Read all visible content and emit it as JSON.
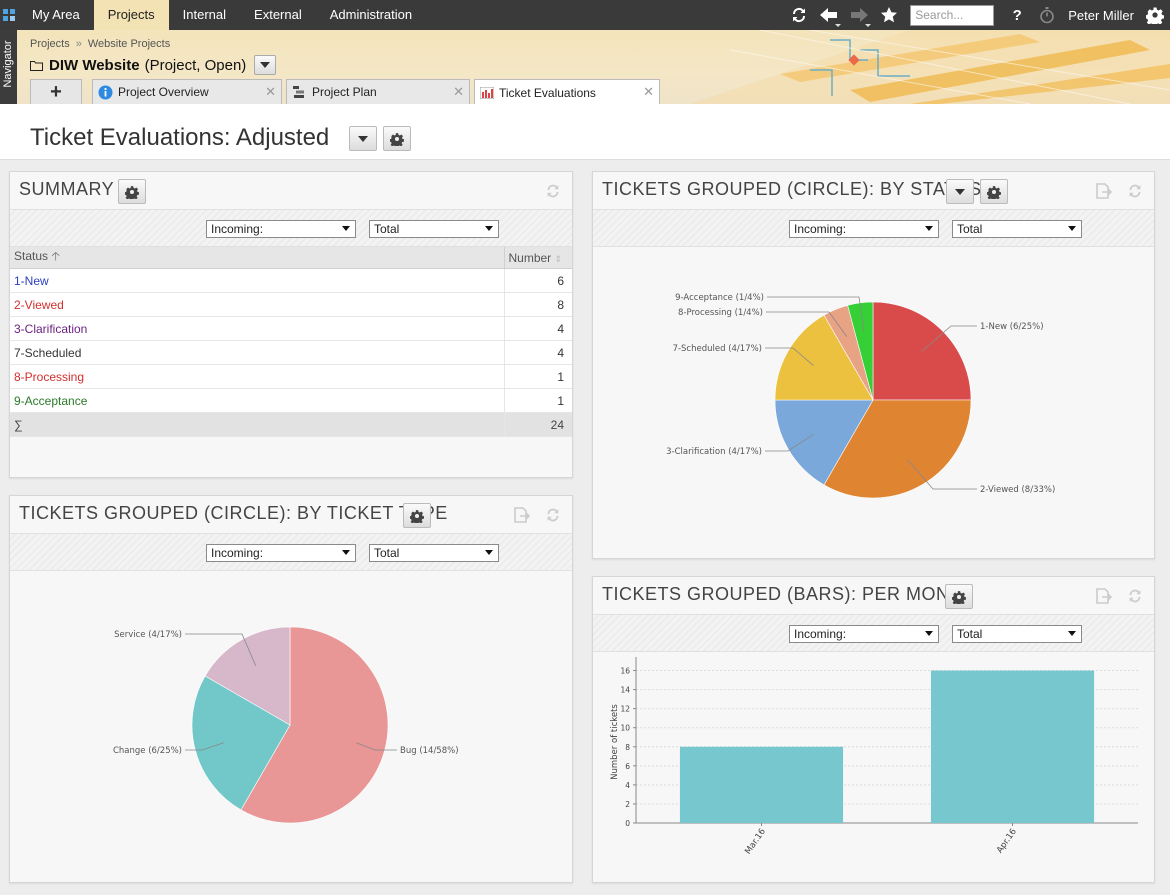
{
  "topbar": {
    "menu": [
      {
        "label": "My Area",
        "active": false
      },
      {
        "label": "Projects",
        "active": true
      },
      {
        "label": "Internal",
        "active": false
      },
      {
        "label": "External",
        "active": false
      },
      {
        "label": "Administration",
        "active": false
      }
    ],
    "search_placeholder": "Search...",
    "user": "Peter Miller",
    "help": "?"
  },
  "navigator_label": "Navigator",
  "breadcrumb": [
    "Projects",
    "Website Projects"
  ],
  "breadcrumb_sep": "»",
  "project": {
    "name": "DIW Website",
    "type": "(Project, Open)"
  },
  "tabs": [
    {
      "label": "Project Overview",
      "icon": "info-icon"
    },
    {
      "label": "Project Plan",
      "icon": "plan-icon"
    },
    {
      "label": "Ticket Evaluations",
      "icon": "chart-icon",
      "active": true
    }
  ],
  "page_title": "Ticket Evaluations: Adjusted",
  "filters": {
    "incoming": "Incoming:",
    "total": "Total"
  },
  "summary": {
    "title": "SUMMARY",
    "col_status": "Status",
    "col_number": "Number",
    "rows": [
      {
        "status": "1-New",
        "number": "6",
        "color": "#2b3fbf"
      },
      {
        "status": "2-Viewed",
        "number": "8",
        "color": "#d0302f"
      },
      {
        "status": "3-Clarification",
        "number": "4",
        "color": "#6a2280"
      },
      {
        "status": "7-Scheduled",
        "number": "4",
        "color": "#333333"
      },
      {
        "status": "8-Processing",
        "number": "1",
        "color": "#d0302f"
      },
      {
        "status": "9-Acceptance",
        "number": "1",
        "color": "#2a7a2a"
      }
    ],
    "sum_symbol": "∑",
    "sum_value": "24"
  },
  "panel_status": {
    "title": "TICKETS GROUPED (CIRCLE): BY STATUS"
  },
  "panel_type": {
    "title": "TICKETS GROUPED (CIRCLE): BY TICKET TYPE"
  },
  "panel_month": {
    "title": "TICKETS GROUPED (BARS): PER MONTH"
  },
  "chart_data": [
    {
      "type": "pie",
      "title": "",
      "slices": [
        {
          "label": "1-New (6/25%)",
          "value": 6,
          "color": "#d94b4b"
        },
        {
          "label": "2-Viewed (8/33%)",
          "value": 8,
          "color": "#df8532"
        },
        {
          "label": "3-Clarification (4/17%)",
          "value": 4,
          "color": "#7ba8db"
        },
        {
          "label": "7-Scheduled (4/17%)",
          "value": 4,
          "color": "#ecc140"
        },
        {
          "label": "8-Processing (1/4%)",
          "value": 1,
          "color": "#e8a284"
        },
        {
          "label": "9-Acceptance (1/4%)",
          "value": 1,
          "color": "#35d035"
        }
      ]
    },
    {
      "type": "pie",
      "title": "",
      "slices": [
        {
          "label": "Bug (14/58%)",
          "value": 14,
          "color": "#e89696"
        },
        {
          "label": "Change (6/25%)",
          "value": 6,
          "color": "#72c8c8"
        },
        {
          "label": "Service (4/17%)",
          "value": 4,
          "color": "#d7b8cb"
        }
      ]
    },
    {
      "type": "bar",
      "title": "",
      "categories": [
        "Mar.16",
        "Apr.16"
      ],
      "values": [
        8,
        16
      ],
      "ylabel": "Number of tickets",
      "ylim": [
        0,
        17
      ],
      "yticks": [
        "0",
        "2",
        "4",
        "6",
        "8",
        "10",
        "12",
        "14",
        "16"
      ],
      "grid": true,
      "color": "#77c7cf"
    }
  ]
}
